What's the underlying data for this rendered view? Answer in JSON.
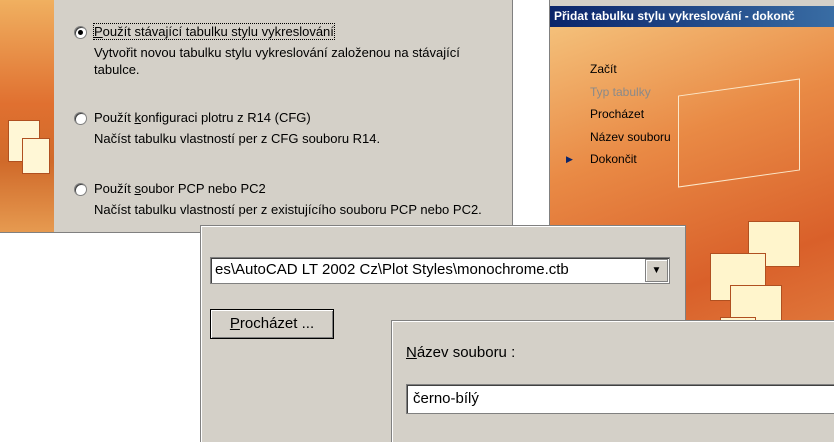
{
  "options": [
    {
      "label": "Použít stávající tabulku stylu vykreslování",
      "underline_index": 0,
      "desc": "Vytvořit novou tabulku stylu vykreslování založenou na stávající tabulce.",
      "checked": true,
      "focused": true
    },
    {
      "label": "Použít konfiguraci plotru z R14 (CFG)",
      "underline_index": 7,
      "desc": "Načíst tabulku vlastností per z CFG souboru R14.",
      "checked": false,
      "focused": false
    },
    {
      "label": "Použít soubor PCP nebo PC2",
      "underline_index": 7,
      "desc": "Načíst tabulku vlastností per z existujícího souboru PCP nebo PC2.",
      "checked": false,
      "focused": false
    }
  ],
  "wizard": {
    "title": "Přidat tabulku stylu vykreslování - dokonč",
    "steps": [
      {
        "label": "Začít",
        "state": "normal"
      },
      {
        "label": "Typ tabulky",
        "state": "disabled"
      },
      {
        "label": "Procházet",
        "state": "normal"
      },
      {
        "label": "Název souboru",
        "state": "normal"
      },
      {
        "label": "Dokončit",
        "state": "current"
      }
    ]
  },
  "browse": {
    "path_value": "es\\AutoCAD LT 2002 Cz\\Plot Styles\\monochrome.ctb",
    "button_label": "Procházet ...",
    "dropdown_icon": "chevron-down-icon"
  },
  "filename": {
    "label": "Název souboru :",
    "value": "černo-bílý"
  },
  "colors": {
    "dialog_face": "#d4d0c8",
    "titlebar": "#0a246a",
    "art_orange": "#e07030"
  }
}
